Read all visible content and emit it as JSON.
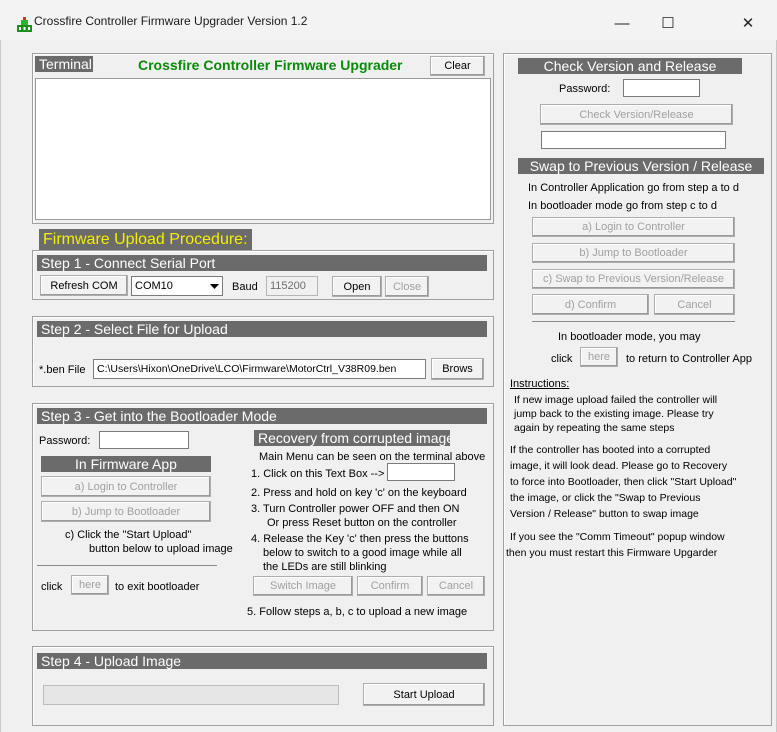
{
  "window": {
    "title": "Crossfire Controller Firmware Upgrader Version 1.2",
    "minimize_glyph": "—",
    "maximize_glyph": "☐",
    "close_glyph": "✕"
  },
  "colors": {
    "accent_green": "#0a8a0a",
    "highlight_yellow": "#f4f000",
    "bar_gray": "#6b6b6b"
  },
  "terminal": {
    "label": "Terminal",
    "heading": "Crossfire Controller Firmware Upgrader",
    "clear_label": "Clear",
    "content": ""
  },
  "procedure": {
    "heading": "Firmware Upload Procedure:"
  },
  "step1": {
    "title": "Step 1 - Connect Serial Port",
    "refresh_label": "Refresh COM",
    "com_value": "COM10",
    "baud_label": "Baud",
    "baud_value": "115200",
    "open_label": "Open",
    "close_label": "Close"
  },
  "step2": {
    "title": "Step 2 - Select File for Upload",
    "file_label": "*.ben File",
    "file_path": "C:\\Users\\Hixon\\OneDrive\\LCO\\Firmware\\MotorCtrl_V38R09.ben",
    "browse_label": "Brows"
  },
  "step3": {
    "title": "Step 3 - Get into the Bootloader Mode",
    "password_label": "Password:",
    "password_value": "",
    "in_app_title": "In Firmware App",
    "login_label": "a) Login to Controller",
    "jump_label": "b) Jump to Bootloader",
    "click_start_line1": "c) Click the \"Start Upload\"",
    "click_start_line2": "button below to upload image",
    "exit_click": "click",
    "exit_here": "here",
    "exit_text": "to exit bootloader",
    "recovery_title": "Recovery from corrupted image",
    "recovery_main_menu": "Main Menu can be seen on the terminal above",
    "recovery_step1": "1. Click on this Text Box -->",
    "recovery_step2": "2. Press and hold on key 'c' on the keyboard",
    "recovery_step3a": "3. Turn Controller power OFF and then ON",
    "recovery_step3b": "Or press Reset button on the controller",
    "recovery_step4a": "4. Release the Key 'c' then press the buttons",
    "recovery_step4b": "below to switch to a good image while all",
    "recovery_step4c": "the LEDs are still blinking",
    "switch_label": "Switch Image",
    "confirm_label": "Confirm",
    "cancel_label": "Cancel",
    "recovery_step5": "5. Follow steps  a, b, c  to upload a new image"
  },
  "step4": {
    "title": "Step 4 - Upload Image",
    "progress": 0,
    "start_label": "Start Upload"
  },
  "right": {
    "check_title": "Check Version and Release",
    "password_label": "Password:",
    "password_value": "",
    "check_button": "Check Version/Release",
    "version_value": "",
    "swap_title": "Swap to Previous Version / Release",
    "swap_info1": "In Controller Application go from step a to d",
    "swap_info2": "In bootloader mode go from step c to d",
    "login_label": "a)  Login to Controller",
    "jump_label": "b)  Jump to Bootloader",
    "swap_label": "c)  Swap to Previous Version/Release",
    "confirm_label": "d)  Confirm",
    "cancel_label": "Cancel",
    "boot_note": "In bootloader mode, you may",
    "return_click": "click",
    "return_here": "here",
    "return_text": "to return to Controller App",
    "instructions_title": "Instructions:",
    "instr1": "If new image upload failed the controller will",
    "instr2": "jump back to the existing image. Please try",
    "instr3": "again by repeating the same steps",
    "instr4": "If the controller has booted into a corrupted",
    "instr5": "image, it will look dead. Please go to Recovery",
    "instr6": "to force into Bootloader, then click \"Start Upload\"",
    "instr7": "the image, or click the \"Swap to Previous",
    "instr8": "Version / Release\" button to swap image",
    "instr9": "If you see the \"Comm Timeout\" popup window",
    "instr10": "then you must restart this Firmware Upgarder"
  }
}
